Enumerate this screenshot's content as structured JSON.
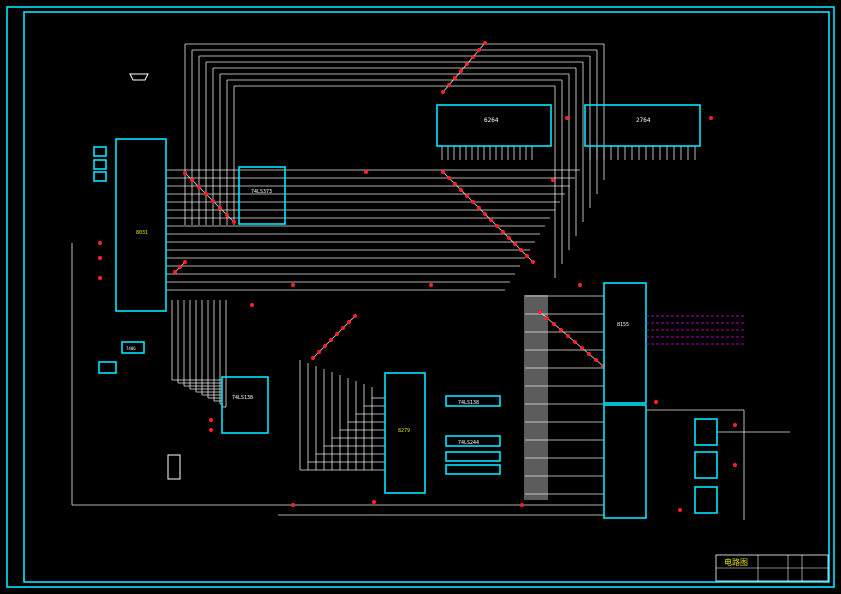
{
  "chips": {
    "cpu": "8031",
    "latch": "74LS373",
    "ram": "6264",
    "rom": "2764",
    "ppi": "8279",
    "timer": "8155",
    "adc": "74LS138",
    "dec1": "74LS138",
    "dec2": "74LS244",
    "reg": "7406"
  },
  "title_block": {
    "title": "电路图"
  }
}
